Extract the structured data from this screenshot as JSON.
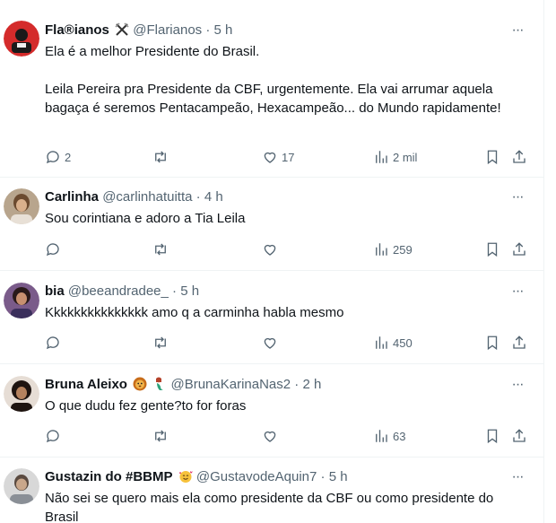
{
  "colors": {
    "text": "#0f1419",
    "muted": "#536471",
    "border": "#eff3f4"
  },
  "icons": {
    "reply": "reply-icon",
    "retweet": "retweet-icon",
    "like": "heart-icon",
    "views": "views-chart-icon",
    "bookmark": "bookmark-icon",
    "share": "share-icon",
    "more": "more-dots-icon"
  },
  "tweets": [
    {
      "display_name": "Fla®ianos",
      "handle": "@Flarianos",
      "dot": "·",
      "time": "5 h",
      "more": "···",
      "text": [
        "Ela é a melhor Presidente do Brasil.",
        "",
        "Leila Pereira pra Presidente da CBF, urgentemente. Ela vai arrumar aquela bagaça é seremos Pentacampeão, Hexacampeão... do Mundo rapidamente!"
      ],
      "replies": "2",
      "retweets": "",
      "likes": "17",
      "views": "2 mil"
    },
    {
      "display_name": "Carlinha",
      "handle": "@carlinhatuitta",
      "dot": "·",
      "time": "4 h",
      "more": "···",
      "text": [
        "Sou corintiana e adoro a Tia Leila"
      ],
      "replies": "",
      "retweets": "",
      "likes": "",
      "views": "259"
    },
    {
      "display_name": "bia",
      "handle": "@beeandradee_",
      "dot": "·",
      "time": "5 h",
      "more": "···",
      "text": [
        "Kkkkkkkkkkkkkkk amo q a carminha habla mesmo"
      ],
      "replies": "",
      "retweets": "",
      "likes": "",
      "views": "450"
    },
    {
      "display_name": "Bruna Aleixo",
      "handle": "@BrunaKarinaNas2",
      "dot": "·",
      "time": "2 h",
      "more": "···",
      "text": [
        "O que dudu fez gente?to for foras"
      ],
      "replies": "",
      "retweets": "",
      "likes": "",
      "views": "63"
    },
    {
      "display_name": "Gustazin do #BBMP",
      "handle": "@GustavodeAquin7",
      "dot": "·",
      "time": "5 h",
      "more": "···",
      "text": [
        "Não sei se quero mais ela como presidente da CBF ou como presidente do Brasil"
      ],
      "replies": "",
      "retweets": "",
      "likes": "",
      "views": ""
    }
  ]
}
